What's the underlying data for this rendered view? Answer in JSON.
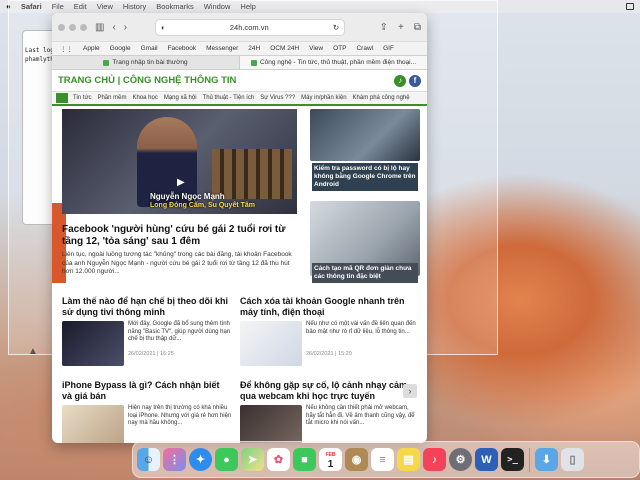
{
  "menubar": {
    "app": "Safari",
    "items": [
      "File",
      "Edit",
      "View",
      "History",
      "Bookmarks",
      "Window",
      "Help"
    ]
  },
  "terminal": {
    "line1": "Last log",
    "line2": "phamlyth"
  },
  "browser": {
    "url": "24h.com.vn",
    "favorites": [
      "Apple",
      "Google",
      "Gmail",
      "Facebook",
      "Messenger",
      "24H",
      "OCM 24H",
      "View",
      "OTP",
      "Crawl",
      "GIF"
    ],
    "tabs": [
      {
        "label": "Trang nhập tin bài thường"
      },
      {
        "label": "Công nghệ - Tin tức, thủ thuật, phần mềm điện thoại..."
      }
    ]
  },
  "site": {
    "title": "TRANG CHỦ | CÔNG NGHỆ THÔNG TIN",
    "subnav": [
      "Tin tức",
      "Phần mềm",
      "Khoa học",
      "Mạng xã hội",
      "Thủ thuật - Tiện ích",
      "Sự Virus ???",
      "Máy in/phần kiện",
      "Khám phá công nghệ"
    ],
    "hero": {
      "caption_name": "Nguyễn Ngọc Mạnh",
      "caption_sub": "Long Đóng Cấm, Su Quyết Tâm",
      "title": "Facebook 'người hùng' cứu bé gái 2 tuổi rơi từ tầng 12, 'tỏa sáng' sau 1 đêm",
      "summary": "Liên tục, ngoài luồng tương tác \"khủng\" trong các bài đăng, tài khoản Facebook của anh Nguyễn Ngọc Mạnh - người cứu bé gái 2 tuổi rơi từ tầng 12 đã thu hút hơn 12.000 người..."
    },
    "side": [
      {
        "title": "Kiểm tra password có bị lộ hay không bằng Google Chrome trên Android"
      },
      {
        "title": "Cách tạo mã QR đơn giản chưa các thông tin đặc biệt"
      }
    ],
    "cards": [
      {
        "title": "Làm thế nào để hạn chế bị theo dõi khi sử dụng tivi thông minh",
        "text": "Mới đây, Google đã bổ sung thêm tính năng \"Basic TV\", giúp người dùng hạn chế bị thu thập dữ...",
        "date": "26/02/2021 | 16:25"
      },
      {
        "title": "Cách xóa tài khoản Google nhanh trên máy tính, điện thoại",
        "text": "Nếu như có một vài vấn đề liên quan đến bảo mật như rò rỉ dữ liệu, lỗ thông tin...",
        "date": "26/02/2021 | 15:20"
      },
      {
        "title": "iPhone Bypass là gì? Cách nhận biết và giá bán",
        "text": "Hiện nay trên thị trường có khá nhiều loại iPhone. Nhưng với giá rẻ hơn hiện nay mà hầu không...",
        "date": "26/02/2021 | 15:41"
      },
      {
        "title": "Để không gặp sự cố, lộ cảnh nhạy cảm qua webcam khi học trực tuyến",
        "text": "Nếu không cần thiết phải mở webcam, hãy tắt hẳn đi. Về âm thanh cũng vậy, để tắt micro khi nói vấn...",
        "date": "26/02/2021 | 13:31"
      }
    ]
  },
  "dock": {
    "calendar_month": "FEB",
    "calendar_day": "1"
  },
  "colors": {
    "accent": "#3a8f2a",
    "brand_red": "#d9582b"
  }
}
